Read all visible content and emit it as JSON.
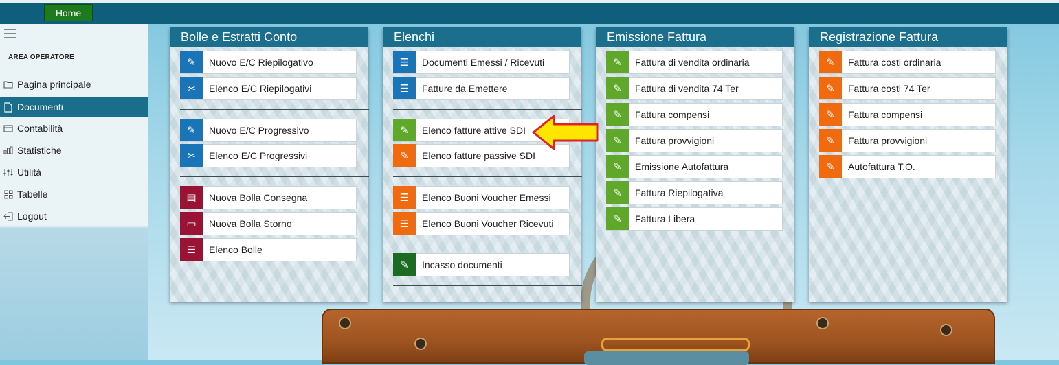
{
  "topbar": {
    "home_label": "Home"
  },
  "sidebar": {
    "area_title": "AREA OPERATORE",
    "items": [
      {
        "label": "Pagina principale",
        "icon": "folder-icon"
      },
      {
        "label": "Documenti",
        "icon": "document-icon",
        "active": true
      },
      {
        "label": "Contabilità",
        "icon": "wallet-icon"
      },
      {
        "label": "Statistiche",
        "icon": "bar-chart-icon"
      },
      {
        "label": "Utilità",
        "icon": "sliders-icon"
      },
      {
        "label": "Tabelle",
        "icon": "grid-icon"
      },
      {
        "label": "Logout",
        "icon": "logout-icon"
      }
    ]
  },
  "panels": [
    {
      "title": "Bolle e Estratti Conto",
      "items": [
        {
          "label": "Nuovo E/C Riepilogativo",
          "color": "#1a74b8",
          "icon": "edit-document-icon"
        },
        {
          "label": "Elenco E/C Riepilogativi",
          "color": "#1a74b8",
          "icon": "scissors-list-icon"
        },
        {
          "label": "Nuovo E/C Progressivo",
          "color": "#1a74b8",
          "icon": "edit-document-icon"
        },
        {
          "label": "Elenco E/C Progressivi",
          "color": "#1a74b8",
          "icon": "scissors-list-icon"
        },
        {
          "label": "Nuova Bolla Consegna",
          "color": "#9a1335",
          "icon": "delivery-note-icon"
        },
        {
          "label": "Nuova Bolla Storno",
          "color": "#9a1335",
          "icon": "folder-icon"
        },
        {
          "label": "Elenco Bolle",
          "color": "#9a1335",
          "icon": "list-icon"
        }
      ]
    },
    {
      "title": "Elenchi",
      "items": [
        {
          "label": "Documenti Emessi / Ricevuti",
          "color": "#1a74b8",
          "icon": "list-icon"
        },
        {
          "label": "Fatture da Emettere",
          "color": "#1a74b8",
          "icon": "list-icon"
        },
        {
          "label": "Elenco fatture attive SDI",
          "color": "#5fa82a",
          "icon": "edit-document-icon"
        },
        {
          "label": "Elenco fatture passive SDI",
          "color": "#f06a0f",
          "icon": "edit-document-icon"
        },
        {
          "label": "Elenco Buoni Voucher Emessi",
          "color": "#f06a0f",
          "icon": "list-icon"
        },
        {
          "label": "Elenco Buoni Voucher Ricevuti",
          "color": "#f06a0f",
          "icon": "list-icon"
        },
        {
          "label": "Incasso documenti",
          "color": "#1b6b22",
          "icon": "edit-document-icon"
        }
      ]
    },
    {
      "title": "Emissione Fattura",
      "items": [
        {
          "label": "Fattura di vendita ordinaria",
          "color": "#5fa82a",
          "icon": "edit-document-icon"
        },
        {
          "label": "Fattura di vendita 74 Ter",
          "color": "#5fa82a",
          "icon": "edit-document-icon"
        },
        {
          "label": "Fattura compensi",
          "color": "#5fa82a",
          "icon": "edit-document-icon"
        },
        {
          "label": "Fattura provvigioni",
          "color": "#5fa82a",
          "icon": "edit-document-icon"
        },
        {
          "label": "Emissione Autofattura",
          "color": "#5fa82a",
          "icon": "edit-document-icon"
        },
        {
          "label": "Fattura Riepilogativa",
          "color": "#5fa82a",
          "icon": "edit-document-icon"
        },
        {
          "label": "Fattura Libera",
          "color": "#5fa82a",
          "icon": "edit-document-icon"
        }
      ]
    },
    {
      "title": "Registrazione Fattura",
      "items": [
        {
          "label": "Fattura costi ordinaria",
          "color": "#f06a0f",
          "icon": "edit-document-icon"
        },
        {
          "label": "Fattura costi 74 Ter",
          "color": "#f06a0f",
          "icon": "edit-document-icon"
        },
        {
          "label": "Fattura compensi",
          "color": "#f06a0f",
          "icon": "edit-document-icon"
        },
        {
          "label": "Fattura provvigioni",
          "color": "#f06a0f",
          "icon": "edit-document-icon"
        },
        {
          "label": "Autofattura T.O.",
          "color": "#f06a0f",
          "icon": "edit-document-icon"
        }
      ]
    }
  ],
  "annotation": {
    "icon": "yellow-arrow-icon",
    "color": "#ffe600",
    "outline": "#e0202a"
  }
}
